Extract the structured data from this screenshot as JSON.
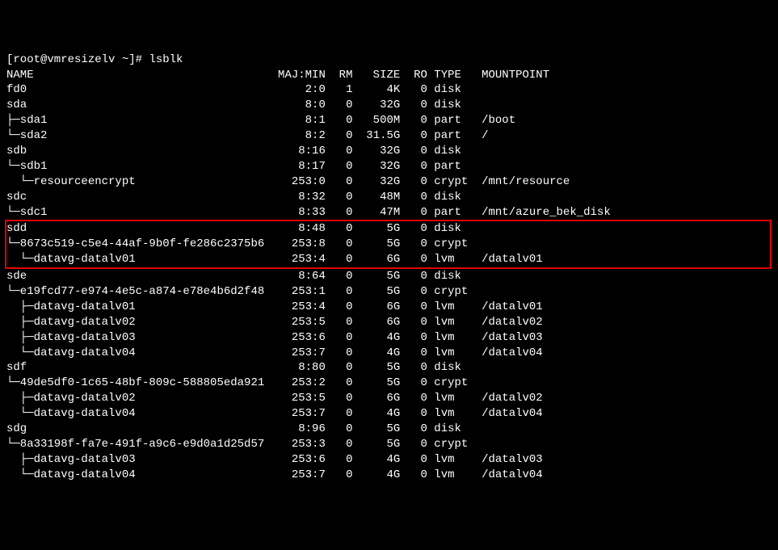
{
  "prompt": "[root@vmresizelv ~]# ",
  "command": "lsblk",
  "header": {
    "name": "NAME",
    "majmin": "MAJ:MIN",
    "rm": "RM",
    "size": "SIZE",
    "ro": "RO",
    "type": "TYPE",
    "mount": "MOUNTPOINT"
  },
  "rows": [
    {
      "name": "fd0",
      "maj": "2:0",
      "rm": "1",
      "size": "4K",
      "ro": "0",
      "type": "disk",
      "mount": ""
    },
    {
      "name": "sda",
      "maj": "8:0",
      "rm": "0",
      "size": "32G",
      "ro": "0",
      "type": "disk",
      "mount": ""
    },
    {
      "name": "├─sda1",
      "maj": "8:1",
      "rm": "0",
      "size": "500M",
      "ro": "0",
      "type": "part",
      "mount": "/boot"
    },
    {
      "name": "└─sda2",
      "maj": "8:2",
      "rm": "0",
      "size": "31.5G",
      "ro": "0",
      "type": "part",
      "mount": "/"
    },
    {
      "name": "sdb",
      "maj": "8:16",
      "rm": "0",
      "size": "32G",
      "ro": "0",
      "type": "disk",
      "mount": ""
    },
    {
      "name": "└─sdb1",
      "maj": "8:17",
      "rm": "0",
      "size": "32G",
      "ro": "0",
      "type": "part",
      "mount": ""
    },
    {
      "name": "  └─resourceencrypt",
      "maj": "253:0",
      "rm": "0",
      "size": "32G",
      "ro": "0",
      "type": "crypt",
      "mount": "/mnt/resource"
    },
    {
      "name": "sdc",
      "maj": "8:32",
      "rm": "0",
      "size": "48M",
      "ro": "0",
      "type": "disk",
      "mount": ""
    },
    {
      "name": "└─sdc1",
      "maj": "8:33",
      "rm": "0",
      "size": "47M",
      "ro": "0",
      "type": "part",
      "mount": "/mnt/azure_bek_disk"
    },
    {
      "name": "sdd",
      "maj": "8:48",
      "rm": "0",
      "size": "5G",
      "ro": "0",
      "type": "disk",
      "mount": "",
      "hl": true
    },
    {
      "name": "└─8673c519-c5e4-44af-9b0f-fe286c2375b6",
      "maj": "253:8",
      "rm": "0",
      "size": "5G",
      "ro": "0",
      "type": "crypt",
      "mount": "",
      "hl": true
    },
    {
      "name": "  └─datavg-datalv01",
      "maj": "253:4",
      "rm": "0",
      "size": "6G",
      "ro": "0",
      "type": "lvm",
      "mount": "/datalv01",
      "hl": true
    },
    {
      "name": "sde",
      "maj": "8:64",
      "rm": "0",
      "size": "5G",
      "ro": "0",
      "type": "disk",
      "mount": ""
    },
    {
      "name": "└─e19fcd77-e974-4e5c-a874-e78e4b6d2f48",
      "maj": "253:1",
      "rm": "0",
      "size": "5G",
      "ro": "0",
      "type": "crypt",
      "mount": ""
    },
    {
      "name": "  ├─datavg-datalv01",
      "maj": "253:4",
      "rm": "0",
      "size": "6G",
      "ro": "0",
      "type": "lvm",
      "mount": "/datalv01"
    },
    {
      "name": "  ├─datavg-datalv02",
      "maj": "253:5",
      "rm": "0",
      "size": "6G",
      "ro": "0",
      "type": "lvm",
      "mount": "/datalv02"
    },
    {
      "name": "  ├─datavg-datalv03",
      "maj": "253:6",
      "rm": "0",
      "size": "4G",
      "ro": "0",
      "type": "lvm",
      "mount": "/datalv03"
    },
    {
      "name": "  └─datavg-datalv04",
      "maj": "253:7",
      "rm": "0",
      "size": "4G",
      "ro": "0",
      "type": "lvm",
      "mount": "/datalv04"
    },
    {
      "name": "sdf",
      "maj": "8:80",
      "rm": "0",
      "size": "5G",
      "ro": "0",
      "type": "disk",
      "mount": ""
    },
    {
      "name": "└─49de5df0-1c65-48bf-809c-588805eda921",
      "maj": "253:2",
      "rm": "0",
      "size": "5G",
      "ro": "0",
      "type": "crypt",
      "mount": ""
    },
    {
      "name": "  ├─datavg-datalv02",
      "maj": "253:5",
      "rm": "0",
      "size": "6G",
      "ro": "0",
      "type": "lvm",
      "mount": "/datalv02"
    },
    {
      "name": "  └─datavg-datalv04",
      "maj": "253:7",
      "rm": "0",
      "size": "4G",
      "ro": "0",
      "type": "lvm",
      "mount": "/datalv04"
    },
    {
      "name": "sdg",
      "maj": "8:96",
      "rm": "0",
      "size": "5G",
      "ro": "0",
      "type": "disk",
      "mount": ""
    },
    {
      "name": "└─8a33198f-fa7e-491f-a9c6-e9d0a1d25d57",
      "maj": "253:3",
      "rm": "0",
      "size": "5G",
      "ro": "0",
      "type": "crypt",
      "mount": ""
    },
    {
      "name": "  ├─datavg-datalv03",
      "maj": "253:6",
      "rm": "0",
      "size": "4G",
      "ro": "0",
      "type": "lvm",
      "mount": "/datalv03"
    },
    {
      "name": "  └─datavg-datalv04",
      "maj": "253:7",
      "rm": "0",
      "size": "4G",
      "ro": "0",
      "type": "lvm",
      "mount": "/datalv04"
    }
  ]
}
